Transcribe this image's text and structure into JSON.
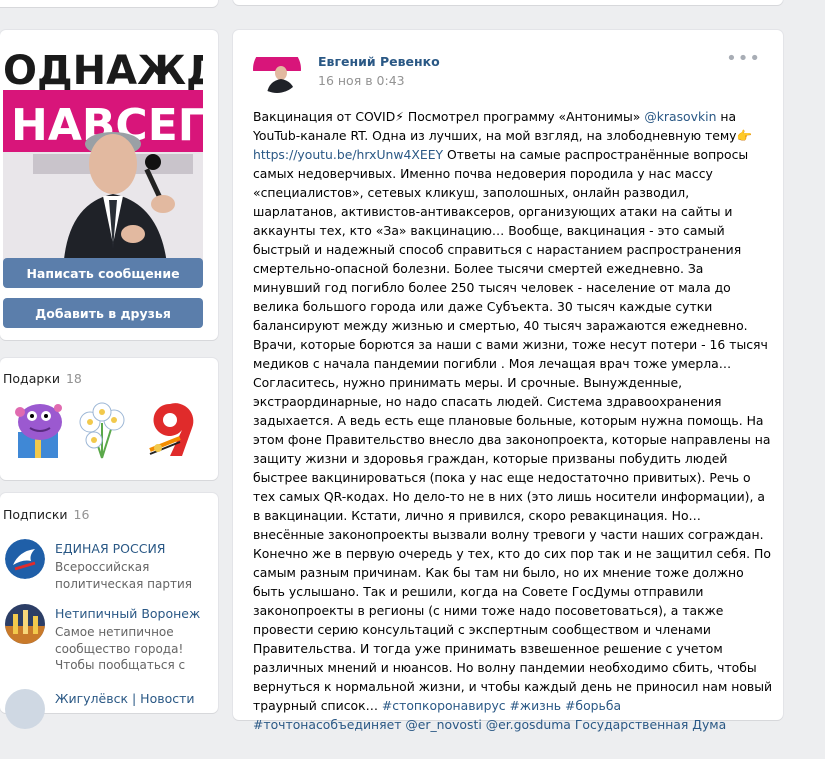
{
  "profile": {
    "photo_text_top": "ОДНАЖДЫ",
    "photo_text_banner": "НАВСЕГДА",
    "message_button": "Написать сообщение",
    "add_friend_button": "Добавить в друзья"
  },
  "gifts": {
    "title": "Подарки",
    "count": "18"
  },
  "subscriptions": {
    "title": "Подписки",
    "count": "16",
    "items": [
      {
        "name": "ЕДИНАЯ РОССИЯ",
        "desc": "Всероссийская политическая партия"
      },
      {
        "name": "Нетипичный Воронеж",
        "desc": "Самое нетипичное сообщество города! Чтобы пообщаться с"
      },
      {
        "name": "Жигулёвск | Новости",
        "desc": ""
      }
    ]
  },
  "post": {
    "author": "Евгений Ревенко",
    "date": "16 ноя в 0:43",
    "menu_label": "•••",
    "t1": "Вакцинация от COVID⚡ Посмотрел программу «Антонимы» ",
    "mention1": "@krasovkin",
    "t2": " на YouTub-канале RT. Одна из лучших, на мой взгляд, на злободневную тему👉 ",
    "url": "https://youtu.be/hrxUnw4XEEY",
    "t3": " Ответы на самые распространённые вопросы самых недоверчивых. Именно почва недоверия породила у нас массу «специалистов», сетевых кликуш, заполошных, онлайн разводил, шарлатанов, активистов-антиваксеров, организующих атаки на сайты и аккаунты тех, кто «За» вакцинацию… Вообще, вакцинация - это самый быстрый и надежный способ справиться с нарастанием распространения смертельно-опасной болезни. Более тысячи смертей ежедневно. За минувший год погибло более 250 тысяч человек - население от мала до велика большого города или даже Субъекта. 30 тысяч каждые сутки балансируют между жизнью и смертью, 40 тысяч заражаются ежедневно. Врачи, которые борются за наши с вами жизни, тоже несут потери - 16 тысяч медиков с начала пандемии погибли . Моя лечащая врач тоже умерла… Согласитесь, нужно принимать меры. И срочные. Вынужденные, экстраординарные, но надо спасать людей. Система здравоохранения задыхается. А ведь есть еще плановые больные, которым нужна помощь. На этом фоне Правительство внесло два законопроекта, которые направлены на защиту жизни и здоровья граждан, которые призваны побудить людей быстрее вакцинироваться (пока у нас еще недостаточно привитых). Речь о тех самых QR-кодах. Но дело-то не в них (это лишь носители информации), а в вакцинации. Кстати, лично я привился, скоро ревакцинация. Но… внесённые законопроекты вызвали волну тревоги у части наших сограждан. Конечно же в первую очередь у тех, кто до сих пор так и не защитил себя. По самым разным причинам. Как бы там ни было, но их мнение тоже должно быть услышано. Так и решили, когда на Совете ГосДумы отправили законопроекты в регионы (с ними тоже надо посоветоваться), а также провести серию консультаций с экспертным сообществом и членами Правительства. И тогда уже принимать взвешенное решение с учетом различных мнений и нюансов. Но волну пандемии необходимо сбить, чтобы вернуться к нормальной жизни, и чтобы каждый день не приносил нам новый траурный список… ",
    "tags1": "#стопкоронавирус #жизнь #борьба",
    "tags2": "#точтонасобъединяет @er_novosti @er.gosduma Государственная Дума"
  },
  "colors": {
    "link": "#2a5885",
    "button": "#5b7eab",
    "page_bg": "#edeef0"
  }
}
